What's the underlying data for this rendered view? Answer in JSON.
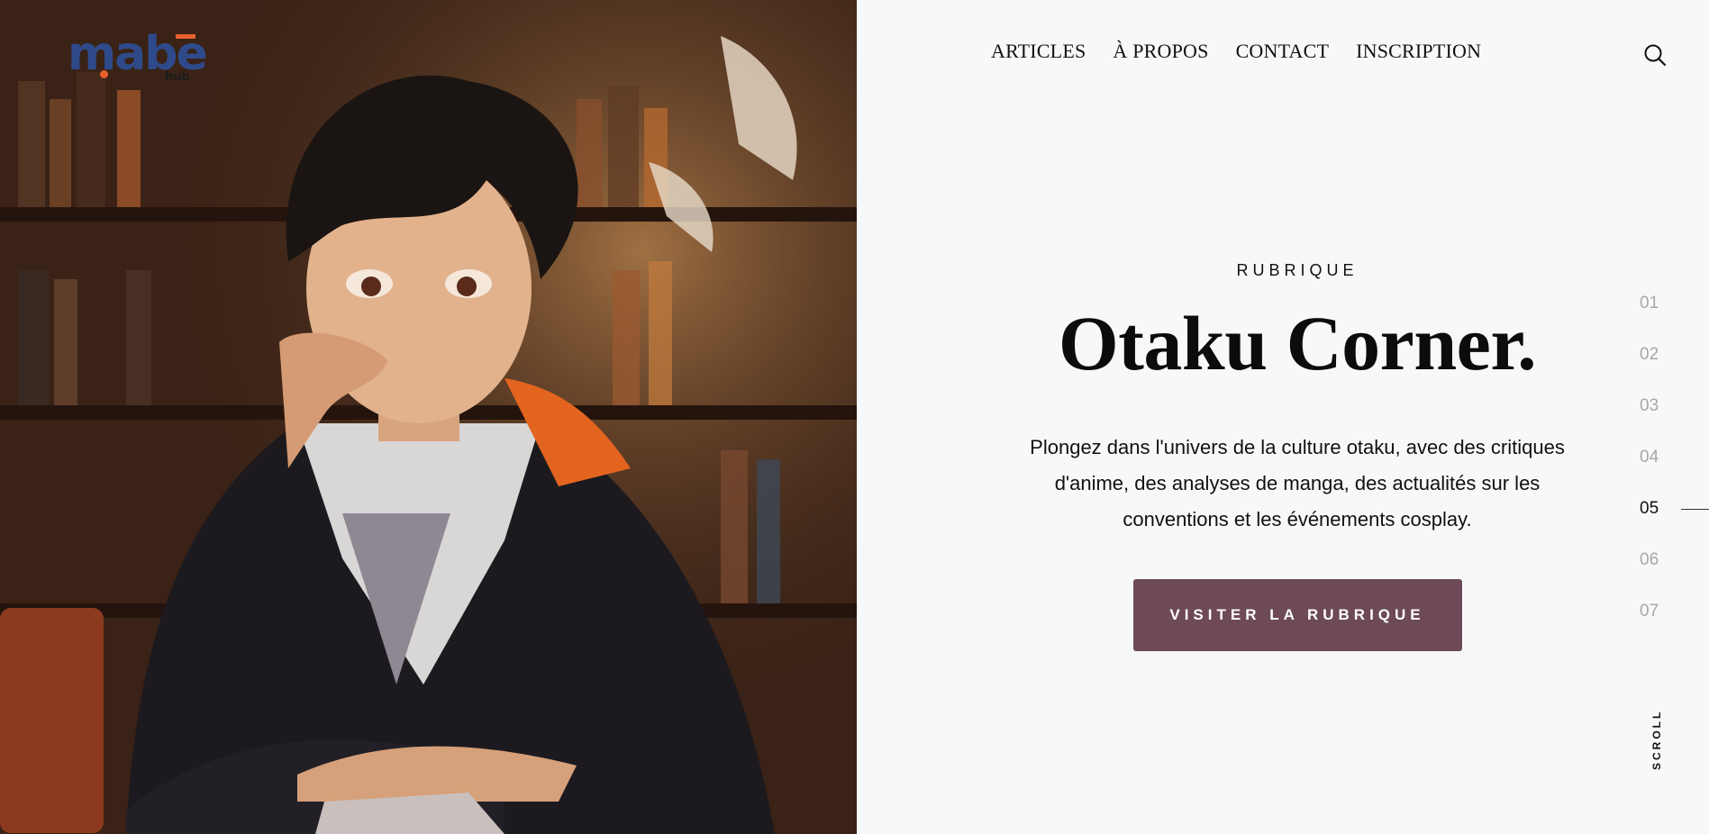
{
  "logo": {
    "text": "mabe",
    "subtext": "hub"
  },
  "nav": {
    "items": [
      "ARTICLES",
      "À PROPOS",
      "CONTACT",
      "INSCRIPTION"
    ]
  },
  "icons": {
    "search": "search-icon"
  },
  "content": {
    "eyebrow": "RUBRIQUE",
    "title": "Otaku Corner.",
    "description": "Plongez dans l'univers de la culture otaku, avec des critiques d'anime, des analyses de manga, des actualités sur les conventions et les événements cosplay.",
    "cta": "VISITER LA RUBRIQUE"
  },
  "pager": {
    "items": [
      "01",
      "02",
      "03",
      "04",
      "05",
      "06",
      "07"
    ],
    "active": "05"
  },
  "scroll_label": "SCROLL",
  "colors": {
    "accent": "#6e4a59",
    "logo_blue": "#2f4a8a",
    "logo_orange": "#e8602c",
    "background": "#f7f8fa"
  }
}
